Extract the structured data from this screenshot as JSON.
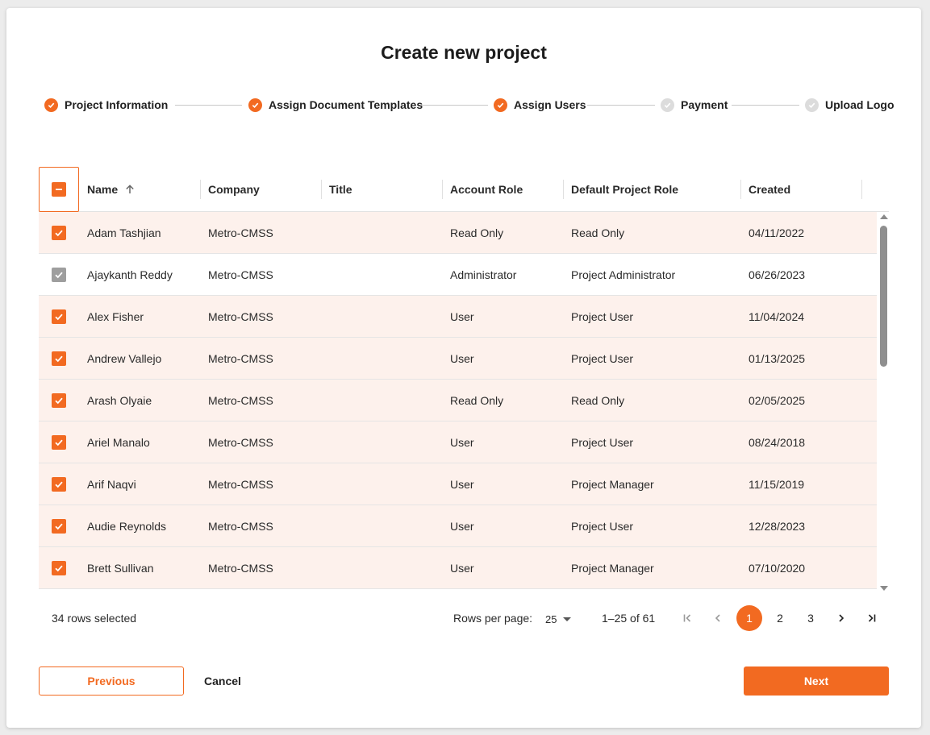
{
  "dialog": {
    "title": "Create new project"
  },
  "stepper": [
    {
      "label": "Project Information",
      "status": "done"
    },
    {
      "label": "Assign Document Templates",
      "status": "done"
    },
    {
      "label": "Assign Users",
      "status": "done"
    },
    {
      "label": "Payment",
      "status": "todo"
    },
    {
      "label": "Upload Logo",
      "status": "todo"
    }
  ],
  "table": {
    "header_checkbox_state": "indeterminate",
    "columns": [
      "Name",
      "Company",
      "Title",
      "Account Role",
      "Default Project Role",
      "Created"
    ],
    "sort": {
      "column": "Name",
      "direction": "ascending",
      "icon": "arrow-up-icon"
    },
    "rows": [
      {
        "checked": true,
        "disabled": false,
        "name": "Adam Tashjian",
        "company": "Metro-CMSS",
        "title": "",
        "account_role": "Read Only",
        "project_role": "Read Only",
        "created": "04/11/2022"
      },
      {
        "checked": true,
        "disabled": true,
        "name": "Ajaykanth Reddy",
        "company": "Metro-CMSS",
        "title": "",
        "account_role": "Administrator",
        "project_role": "Project Administrator",
        "created": "06/26/2023"
      },
      {
        "checked": true,
        "disabled": false,
        "name": "Alex Fisher",
        "company": "Metro-CMSS",
        "title": "",
        "account_role": "User",
        "project_role": "Project User",
        "created": "11/04/2024"
      },
      {
        "checked": true,
        "disabled": false,
        "name": "Andrew Vallejo",
        "company": "Metro-CMSS",
        "title": "",
        "account_role": "User",
        "project_role": "Project User",
        "created": "01/13/2025"
      },
      {
        "checked": true,
        "disabled": false,
        "name": "Arash Olyaie",
        "company": "Metro-CMSS",
        "title": "",
        "account_role": "Read Only",
        "project_role": "Read Only",
        "created": "02/05/2025"
      },
      {
        "checked": true,
        "disabled": false,
        "name": "Ariel Manalo",
        "company": "Metro-CMSS",
        "title": "",
        "account_role": "User",
        "project_role": "Project User",
        "created": "08/24/2018"
      },
      {
        "checked": true,
        "disabled": false,
        "name": "Arif Naqvi",
        "company": "Metro-CMSS",
        "title": "",
        "account_role": "User",
        "project_role": "Project Manager",
        "created": "11/15/2019"
      },
      {
        "checked": true,
        "disabled": false,
        "name": "Audie Reynolds",
        "company": "Metro-CMSS",
        "title": "",
        "account_role": "User",
        "project_role": "Project User",
        "created": "12/28/2023"
      },
      {
        "checked": true,
        "disabled": false,
        "name": "Brett Sullivan",
        "company": "Metro-CMSS",
        "title": "",
        "account_role": "User",
        "project_role": "Project Manager",
        "created": "07/10/2020"
      }
    ]
  },
  "footer": {
    "selected_text": "34 rows selected",
    "rows_per_page_label": "Rows per page:",
    "rows_per_page_value": "25",
    "range_text": "1–25 of 61",
    "pages": [
      "1",
      "2",
      "3"
    ],
    "current_page": "1"
  },
  "actions": {
    "previous_label": "Previous",
    "cancel_label": "Cancel",
    "next_label": "Next"
  },
  "colors": {
    "accent": "#f26a21",
    "selected_row_bg": "#fdf1ec",
    "disabled_checkbox": "#9e9e9e"
  }
}
